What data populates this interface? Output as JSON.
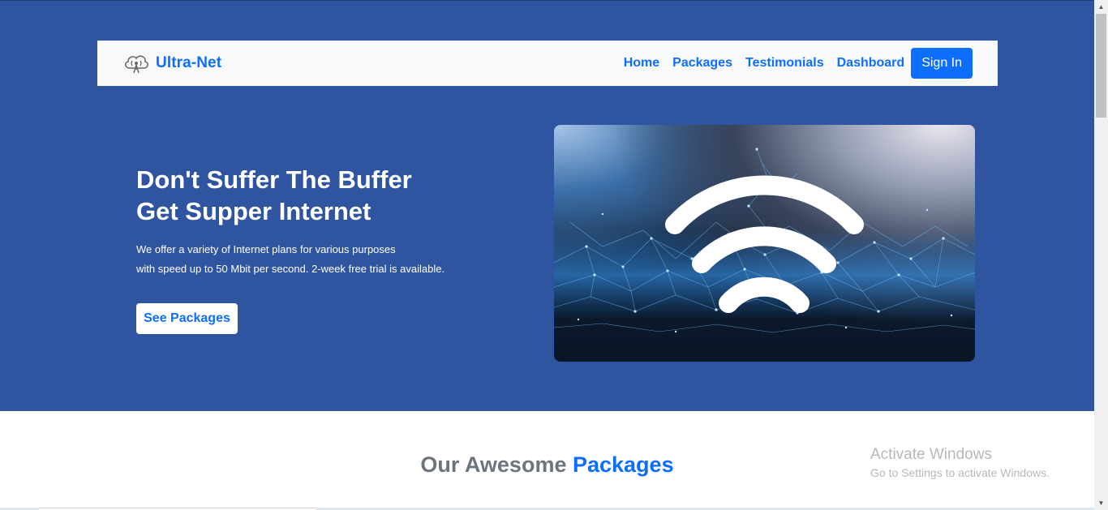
{
  "navbar": {
    "brand": "Ultra-Net",
    "brand_icon": "cloud-antenna-icon",
    "links": [
      "Home",
      "Packages",
      "Testimonials",
      "Dashboard"
    ],
    "signin_label": "Sign In"
  },
  "hero": {
    "title_line1": "Don't Suffer The Buffer",
    "title_line2": "Get Supper Internet",
    "text_line1": "We offer a variety of Internet plans for various purposes",
    "text_line2": "with speed up to 50 Mbit per second. 2-week free trial is available.",
    "button_label": "See Packages",
    "image_icon": "wifi-icon"
  },
  "packages": {
    "title_prefix": "Our Awesome",
    "title_accent": "Packages"
  },
  "watermark": {
    "title": "Activate Windows",
    "subtitle": "Go to Settings to activate Windows."
  },
  "colors": {
    "hero_background": "#2f55a1",
    "accent": "#0d6efd",
    "navbar_background": "#f8f9fa"
  }
}
